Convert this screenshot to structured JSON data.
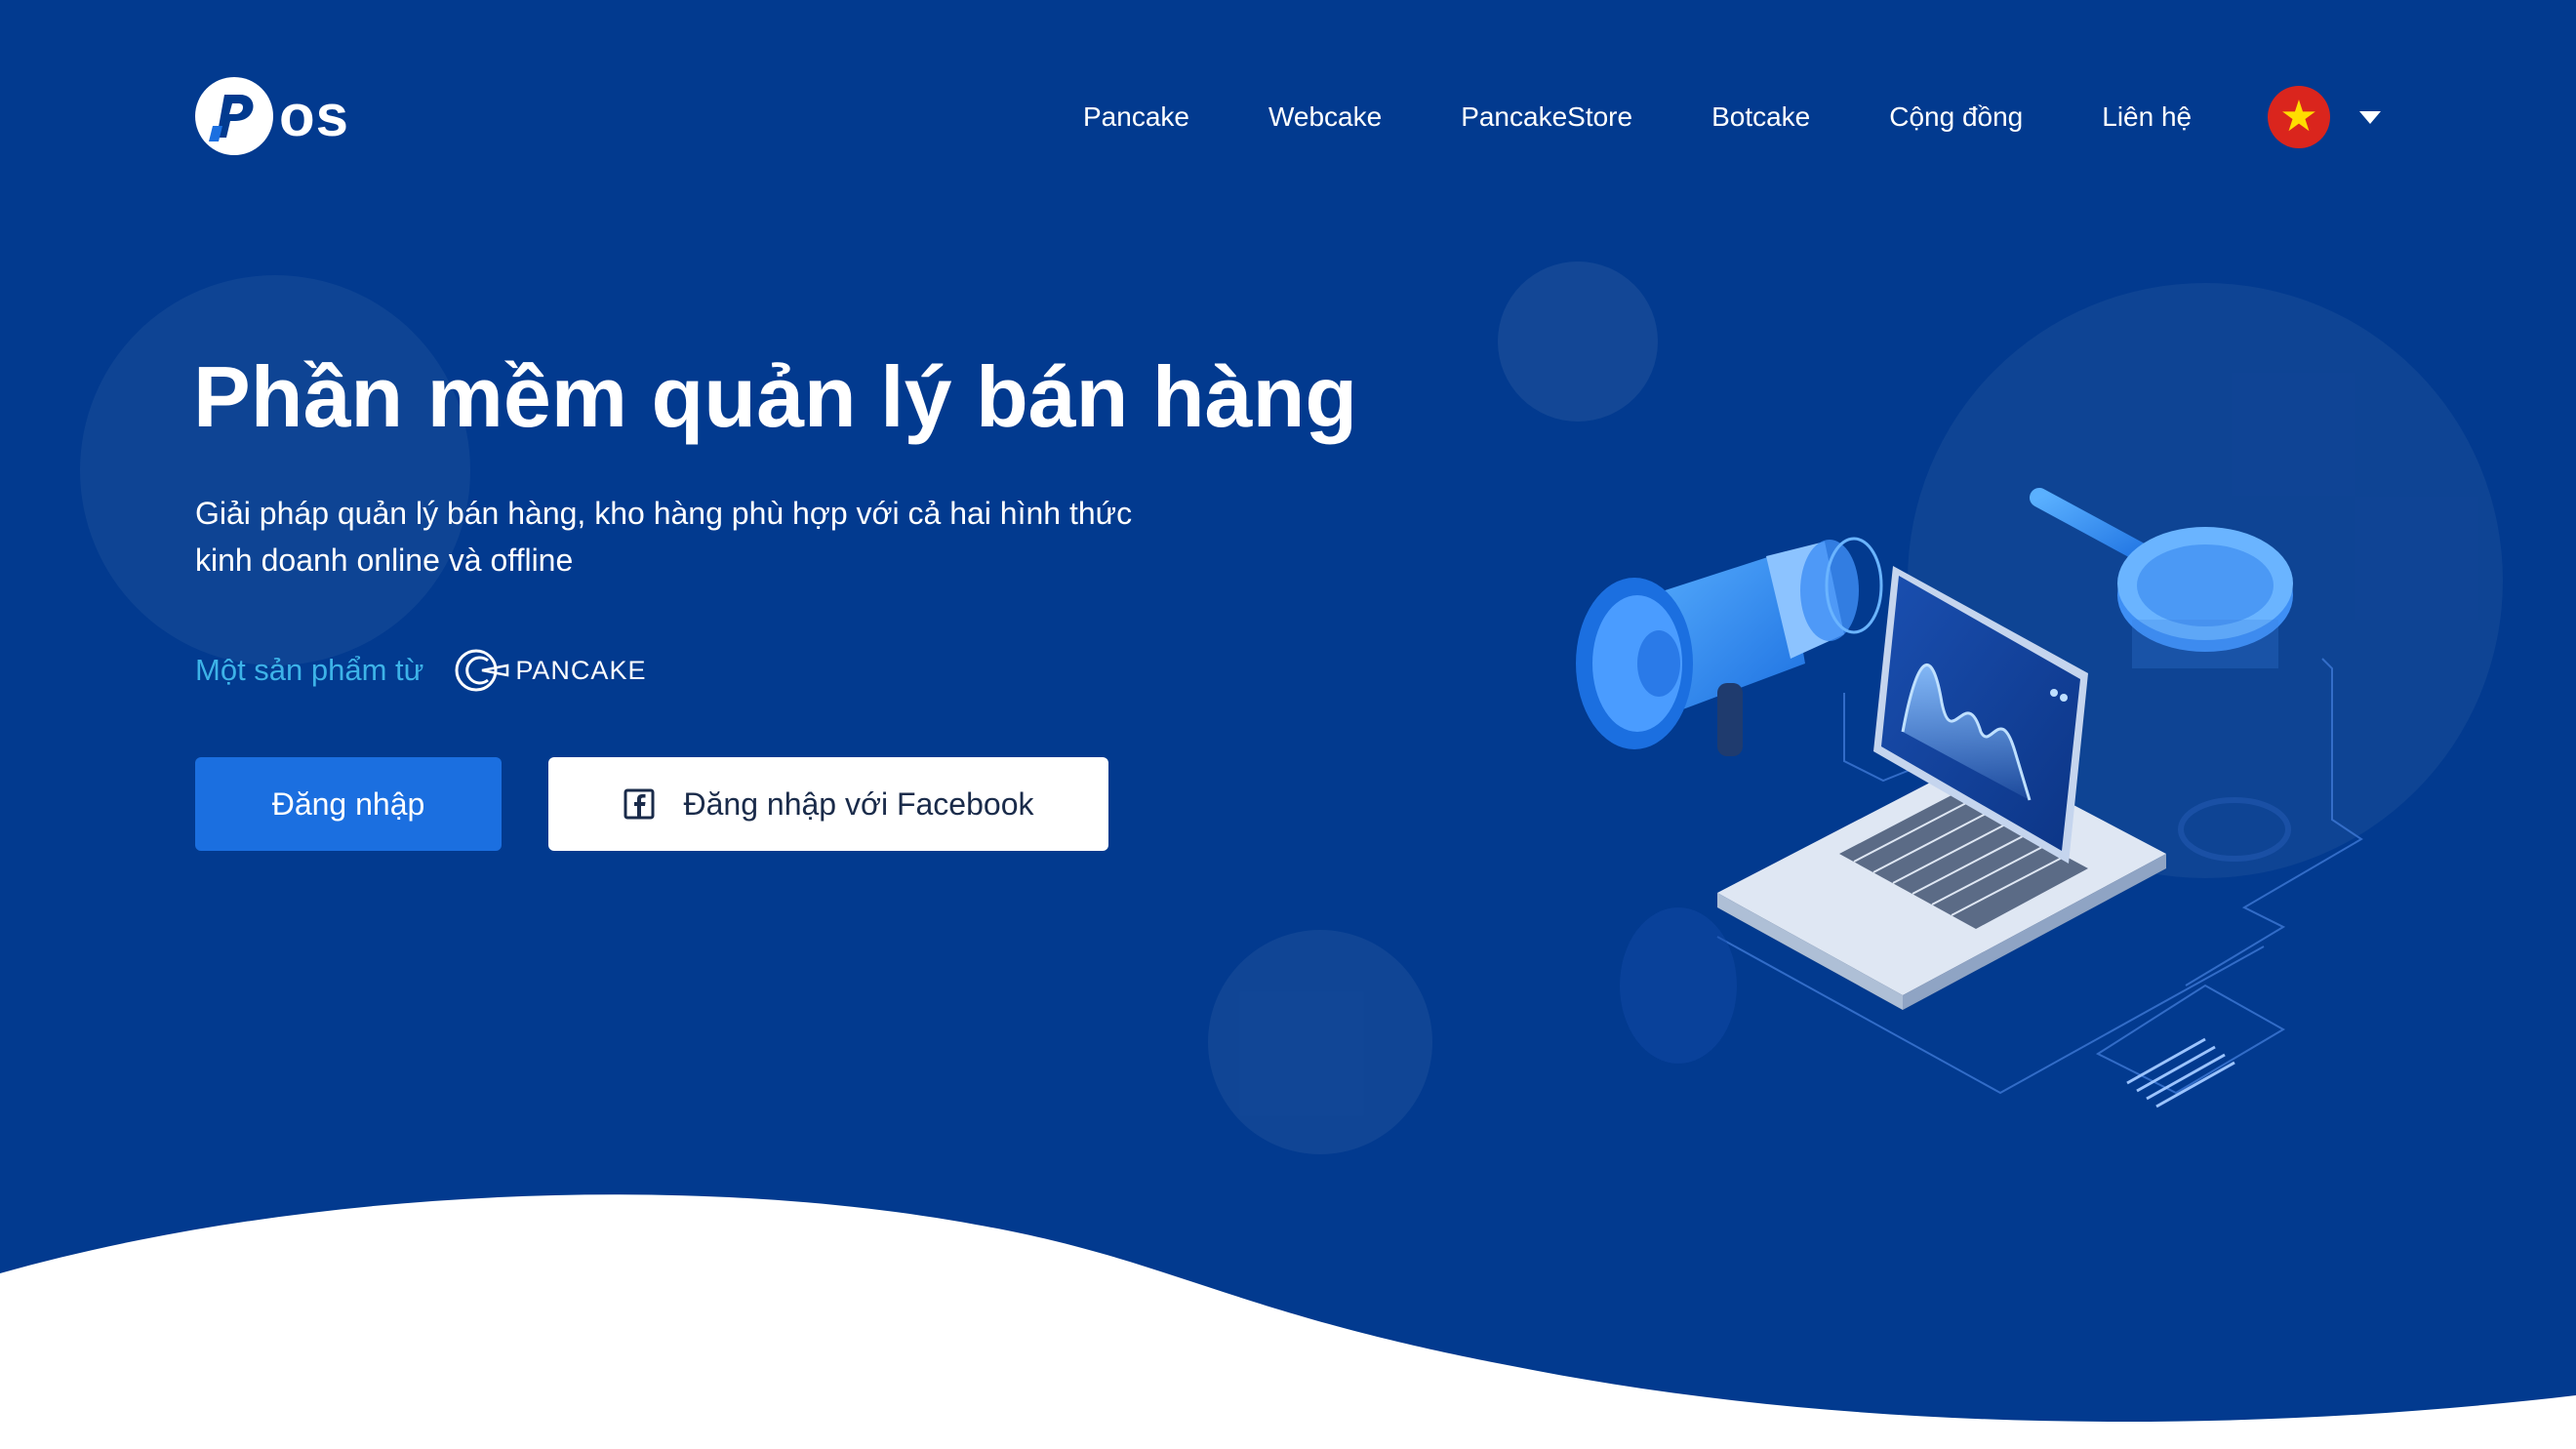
{
  "brand": {
    "logo_text": "os",
    "logo_icon": "pos-logo-p"
  },
  "nav": {
    "items": [
      {
        "label": "Pancake"
      },
      {
        "label": "Webcake"
      },
      {
        "label": "PancakeStore"
      },
      {
        "label": "Botcake"
      },
      {
        "label": "Cộng đồng"
      },
      {
        "label": "Liên hệ"
      }
    ],
    "language": {
      "flag": "vietnam-flag-icon",
      "star": "★"
    }
  },
  "hero": {
    "title": "Phần mềm quản lý bán hàng",
    "subtitle_line1": "Giải pháp quản lý bán hàng, kho hàng phù hợp với cả hai hình thức",
    "subtitle_line2": "kinh doanh online và offline",
    "product_by": "Một sản phẩm từ",
    "partner_brand": "PANCAKE",
    "login_button": "Đăng nhập",
    "facebook_button": "Đăng nhập với Facebook"
  },
  "colors": {
    "background": "#023a8f",
    "primary_button": "#1b6fe0",
    "accent_text": "#3db3e8",
    "flag_red": "#da251d",
    "flag_star": "#ffdd00"
  }
}
